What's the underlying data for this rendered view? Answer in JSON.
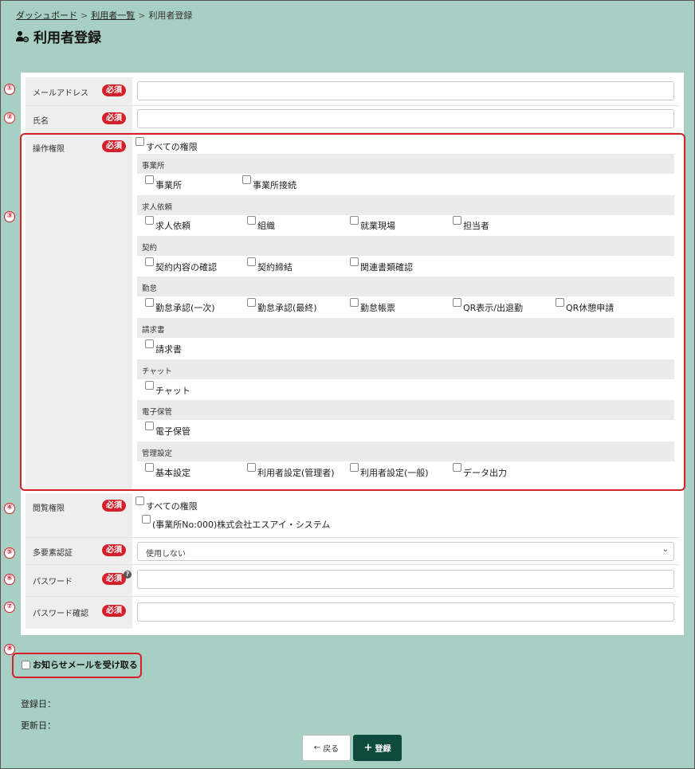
{
  "breadcrumb": {
    "items": [
      "ダッシュボード",
      "利用者一覧",
      "利用者登録"
    ],
    "sep": ">"
  },
  "page_title": "利用者登録",
  "required_label": "必須",
  "markers": [
    "①",
    "②",
    "③",
    "④",
    "⑤",
    "⑥",
    "⑦",
    "⑧"
  ],
  "fields": {
    "email": {
      "label": "メールアドレス",
      "value": ""
    },
    "name": {
      "label": "氏名",
      "value": ""
    },
    "operation_permission": {
      "label": "操作権限",
      "all_label": "すべての権限"
    },
    "view_permission": {
      "label": "閲覧権限",
      "all_label": "すべての権限",
      "office_label": "(事業所No:000)株式会社エスアイ・システム"
    },
    "mfa": {
      "label": "多要素認証",
      "selected": "使用しない"
    },
    "password": {
      "label": "パスワード",
      "value": "",
      "help": "?"
    },
    "password_confirm": {
      "label": "パスワード確認",
      "value": ""
    }
  },
  "permission_groups": [
    {
      "title": "事業所",
      "items": [
        "事業所",
        "事業所接続"
      ]
    },
    {
      "title": "求人依頼",
      "items": [
        "求人依頼",
        "組織",
        "就業現場",
        "担当者"
      ]
    },
    {
      "title": "契約",
      "items": [
        "契約内容の確認",
        "契約締結",
        "関連書類確認"
      ]
    },
    {
      "title": "勤怠",
      "items": [
        "勤怠承認(一次)",
        "勤怠承認(最終)",
        "勤怠帳票",
        "QR表示/出退勤",
        "QR休憩申請"
      ]
    },
    {
      "title": "請求書",
      "items": [
        "請求書"
      ]
    },
    {
      "title": "チャット",
      "items": [
        "チャット"
      ]
    },
    {
      "title": "電子保管",
      "items": [
        "電子保管"
      ]
    },
    {
      "title": "管理設定",
      "items": [
        "基本設定",
        "利用者設定(管理者)",
        "利用者設定(一般)",
        "データ出力"
      ]
    }
  ],
  "notify_label": "お知らせメールを受け取る",
  "meta": {
    "created_label": "登録日：",
    "updated_label": "更新日："
  },
  "buttons": {
    "back_label": "戻る",
    "submit_label": "登録",
    "back_icon": "←",
    "submit_icon": "+"
  },
  "colors": {
    "background": "#a8cfc4",
    "required": "#d3202b",
    "primary": "#0f4a3f"
  }
}
